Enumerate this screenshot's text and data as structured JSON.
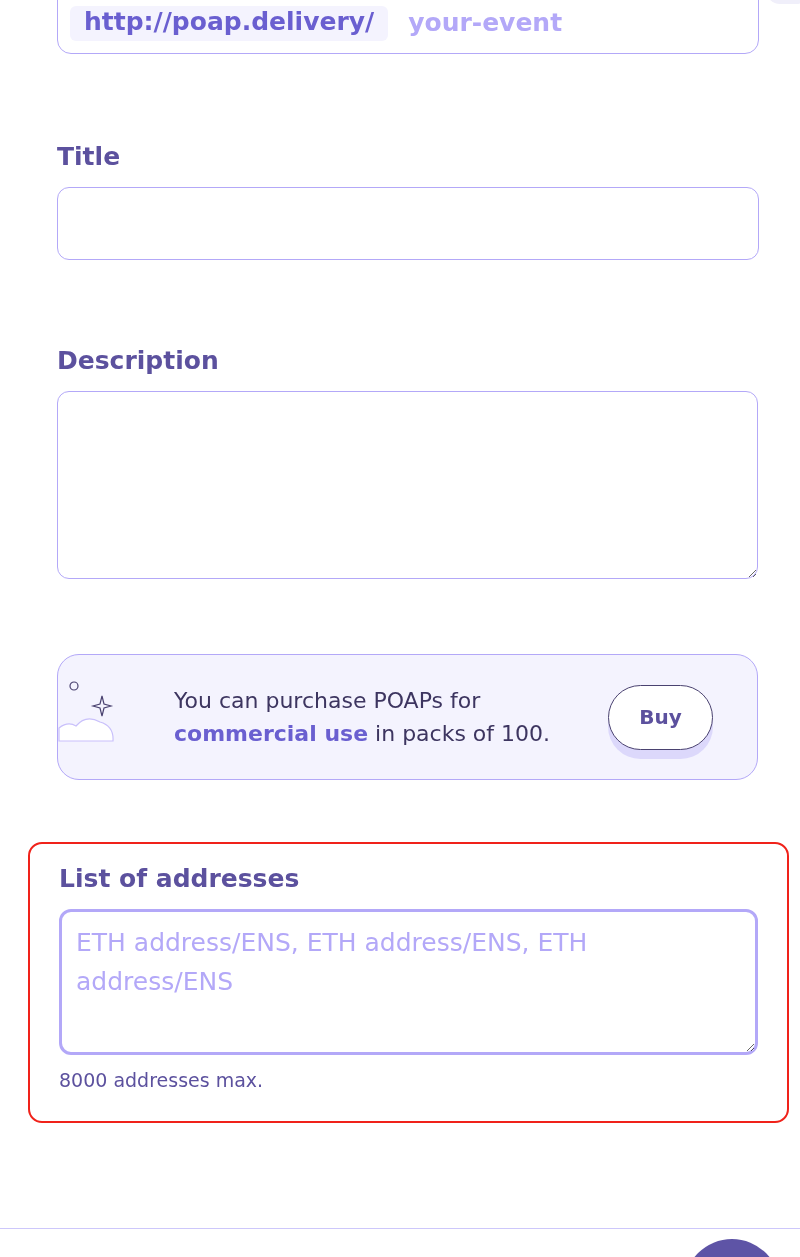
{
  "url_field": {
    "prefix": "http://poap.delivery/",
    "placeholder": "your-event"
  },
  "title_field": {
    "label": "Title"
  },
  "description_field": {
    "label": "Description"
  },
  "promo": {
    "text": "You can purchase POAPs for **commercial use** in packs of 100.",
    "button": "Buy"
  },
  "addresses_field": {
    "label": "List of addresses",
    "placeholder": "ETH address/ENS, ETH address/ENS, ETH address/ENS",
    "hint": "8000 addresses max.",
    "highlighted": true
  }
}
